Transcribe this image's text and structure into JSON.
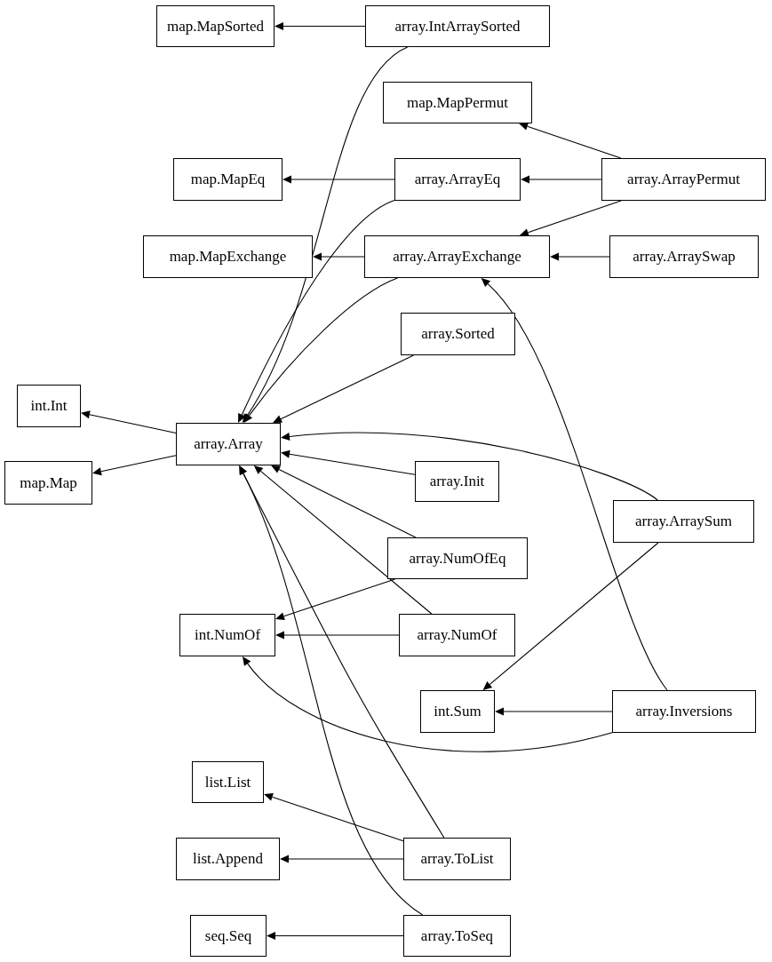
{
  "nodes": [
    {
      "label": "map.MapSorted"
    },
    {
      "label": "array.IntArraySorted"
    },
    {
      "label": "map.MapPermut"
    },
    {
      "label": "map.MapEq"
    },
    {
      "label": "array.ArrayEq"
    },
    {
      "label": "array.ArrayPermut"
    },
    {
      "label": "map.MapExchange"
    },
    {
      "label": "array.ArrayExchange"
    },
    {
      "label": "array.ArraySwap"
    },
    {
      "label": "array.Sorted"
    },
    {
      "label": "int.Int"
    },
    {
      "label": "array.Array"
    },
    {
      "label": "map.Map"
    },
    {
      "label": "array.Init"
    },
    {
      "label": "array.ArraySum"
    },
    {
      "label": "array.NumOfEq"
    },
    {
      "label": "int.NumOf"
    },
    {
      "label": "array.NumOf"
    },
    {
      "label": "int.Sum"
    },
    {
      "label": "array.Inversions"
    },
    {
      "label": "list.List"
    },
    {
      "label": "list.Append"
    },
    {
      "label": "array.ToList"
    },
    {
      "label": "seq.Seq"
    },
    {
      "label": "array.ToSeq"
    }
  ]
}
